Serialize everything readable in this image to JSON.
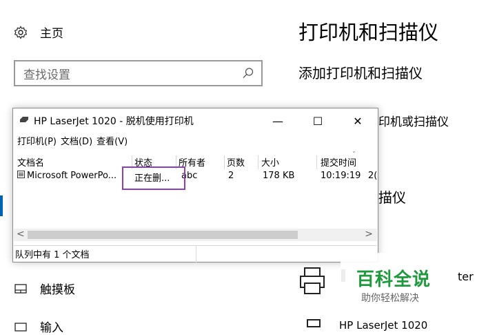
{
  "sidebar": {
    "home_label": "主页",
    "search_placeholder": "查找设置",
    "items": [
      {
        "label": "触摸板"
      },
      {
        "label": "输入"
      }
    ]
  },
  "main": {
    "page_title": "打印机和扫描仪",
    "add_section_title": "添加打印机和扫描仪",
    "partial_add_text": "印机或扫描仪",
    "partial_section_text": "描仪",
    "printer_item_partial": "ter",
    "printer_bottom_name": "HP LaserJet 1020"
  },
  "queue_window": {
    "title": "HP LaserJet 1020  -  脱机使用打印机",
    "controls": {
      "minimize": "—",
      "maximize": "☐",
      "close": "✕"
    },
    "menu": [
      "打印机(P)",
      "文档(D)",
      "查看(V)"
    ],
    "columns": [
      "文档名",
      "状态",
      "所有者",
      "页数",
      "大小",
      "提交时间"
    ],
    "rows": [
      {
        "document": "Microsoft PowerPo...",
        "status": "正在删...",
        "owner": "abc",
        "pages": "2",
        "size": "178 KB",
        "submitted": "10:19:19",
        "extra": "2("
      }
    ],
    "status_text": "队列中有 1 个文档"
  },
  "watermark": {
    "title": "百科全说",
    "subtitle": "助你轻松解决"
  },
  "colors": {
    "accent": "#0063b1",
    "highlight_box": "#8e3fb8",
    "watermark_green": "#1e9a3c"
  }
}
